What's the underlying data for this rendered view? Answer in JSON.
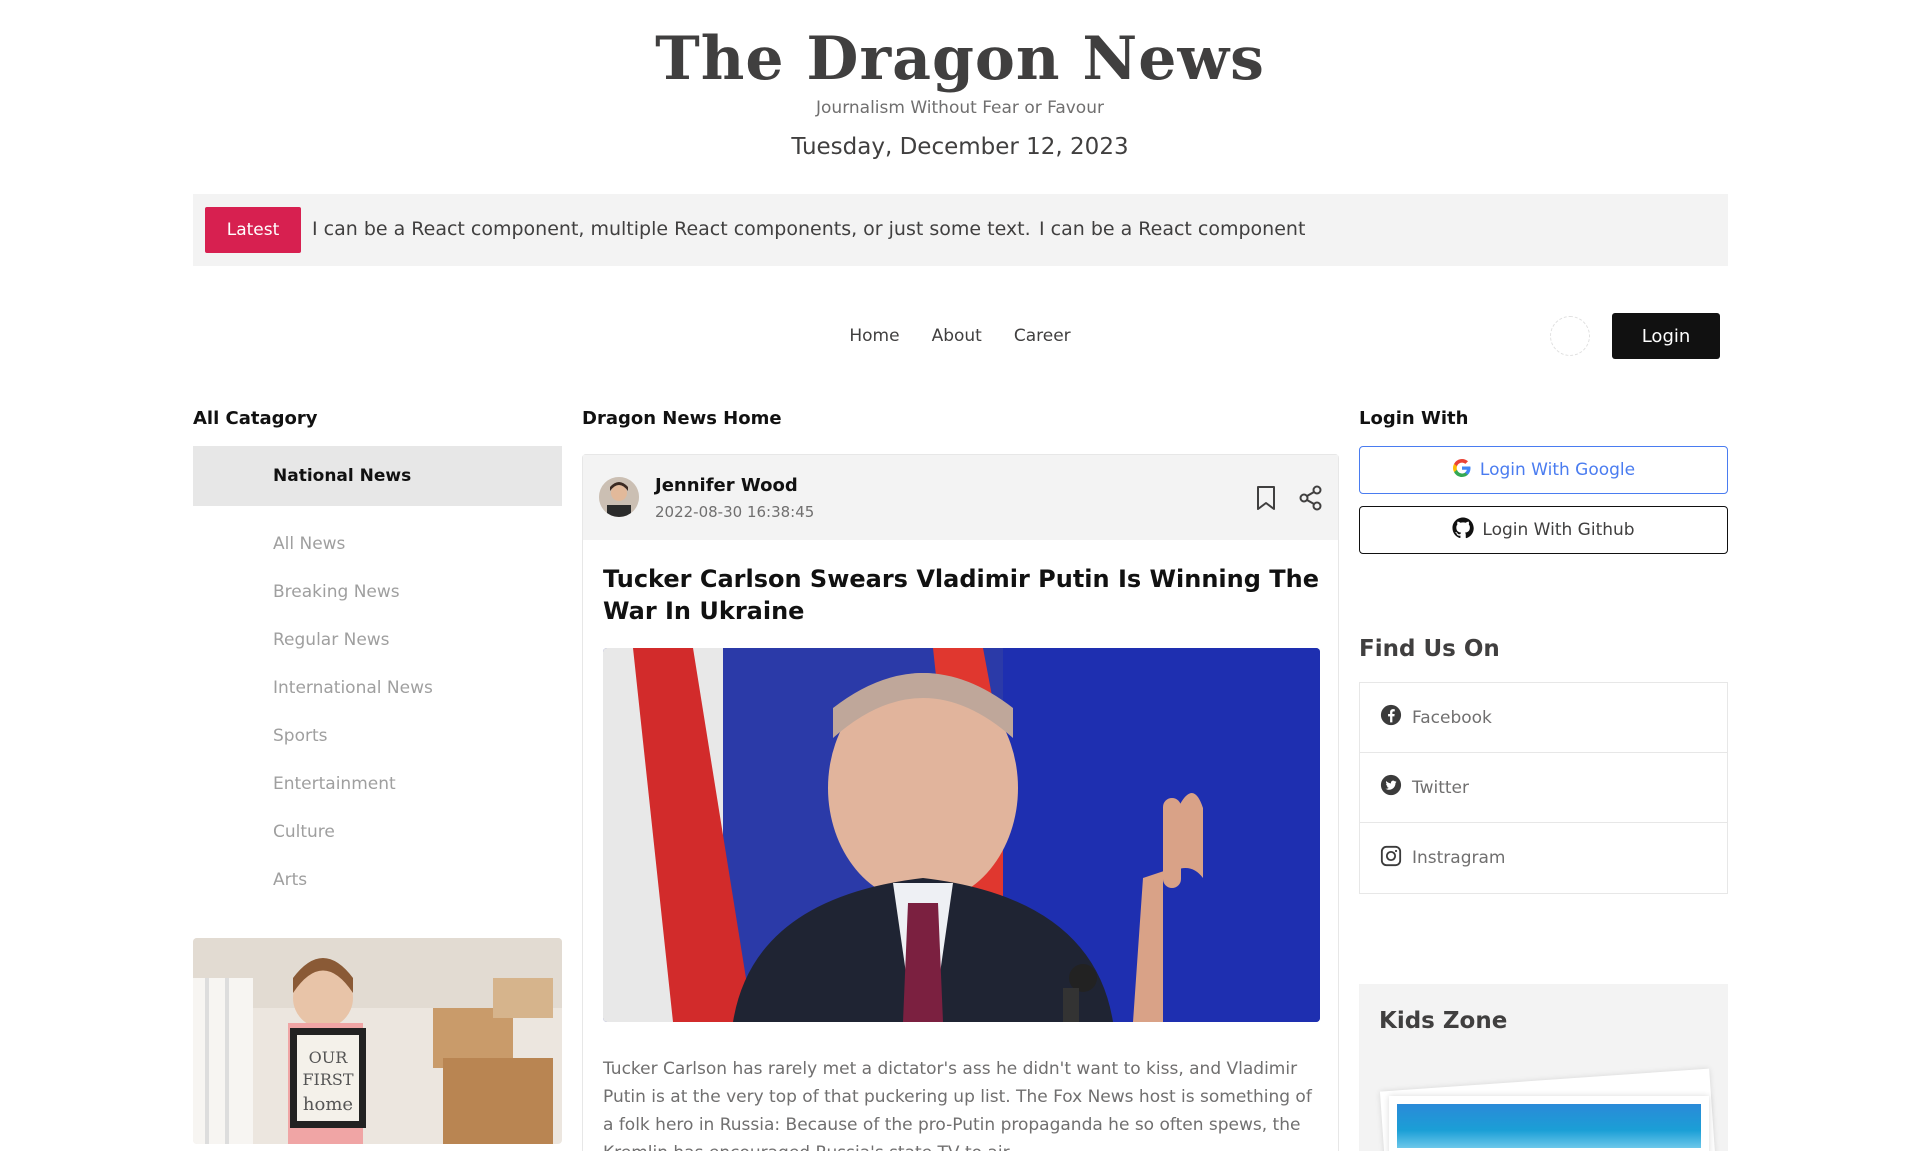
{
  "header": {
    "title": "The Dragon News",
    "tagline": "Journalism Without Fear or Favour",
    "date": "Tuesday, December 12, 2023"
  },
  "ticker": {
    "badge": "Latest",
    "text_1": "I can be a React component, multiple React components, or just some text.",
    "text_2": "I can be a React component"
  },
  "nav": {
    "items": [
      "Home",
      "About",
      "Career"
    ],
    "login_label": "Login"
  },
  "left": {
    "heading": "All Catagory",
    "active_category": "National News",
    "categories": [
      "All News",
      "Breaking News",
      "Regular News",
      "International News",
      "Sports",
      "Entertainment",
      "Culture",
      "Arts"
    ],
    "photo_caption": "OUR FIRST home"
  },
  "center": {
    "heading": "Dragon News Home",
    "article": {
      "author": "Jennifer Wood",
      "published": "2022-08-30 16:38:45",
      "title": "Tucker Carlson Swears Vladimir Putin Is Winning The War In Ukraine",
      "body": "Tucker Carlson has rarely met a dictator's ass he didn't want to kiss, and Vladimir Putin is at the very top of that puckering up list. The Fox News host is something of a folk hero in Russia: Because of the pro-Putin propaganda he so often spews, the Kremlin has encouraged Russia's state TV to air"
    }
  },
  "right": {
    "login_heading": "Login With",
    "google_label": "Login With Google",
    "github_label": "Login With Github",
    "find_heading": "Find Us On",
    "socials": [
      "Facebook",
      "Twitter",
      "Instragram"
    ],
    "kids_heading": "Kids Zone"
  },
  "colors": {
    "accent": "#d72050",
    "google": "#4a7cf0",
    "dark": "#111111"
  }
}
